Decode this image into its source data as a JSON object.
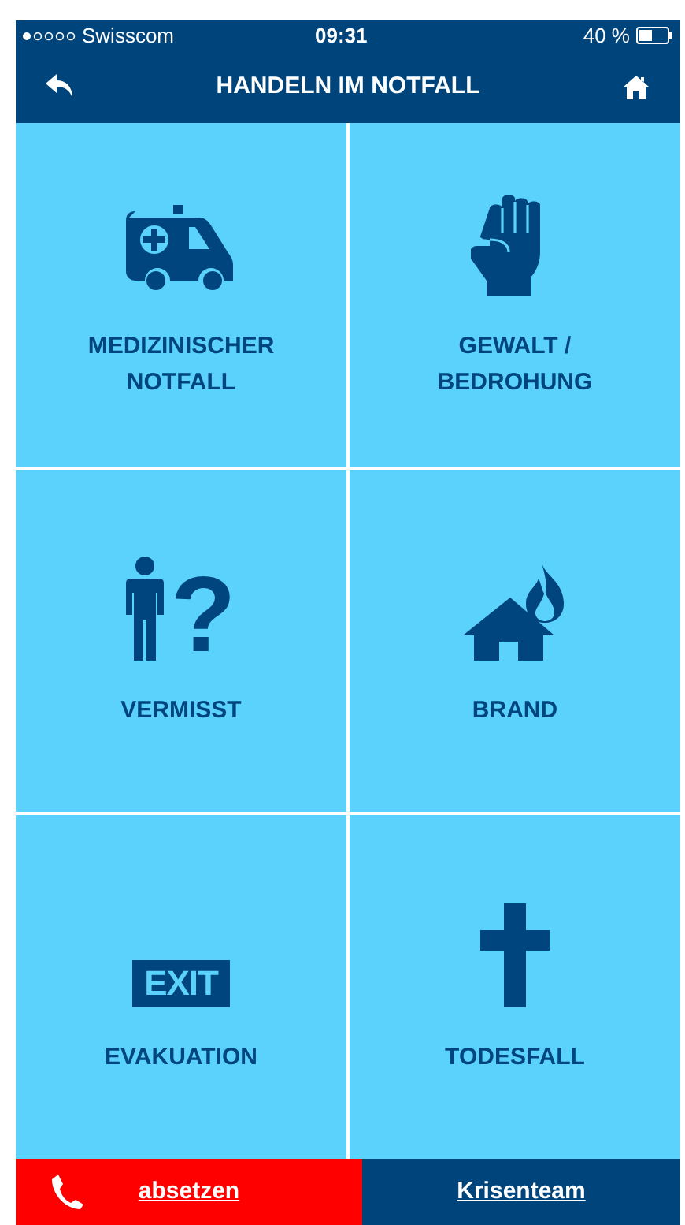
{
  "status_bar": {
    "carrier": "Swisscom",
    "time": "09:31",
    "battery": "40 %"
  },
  "nav_bar": {
    "title": "HANDELN IM NOTFALL"
  },
  "tiles": [
    {
      "kind": "ambulance",
      "label": "MEDIZINISCHER NOTFALL"
    },
    {
      "kind": "fist",
      "label": "GEWALT / BEDROHUNG"
    },
    {
      "kind": "missing-person",
      "icon_text": "?",
      "label": "VERMISST"
    },
    {
      "kind": "house-fire",
      "label": "BRAND"
    },
    {
      "kind": "exit-sign",
      "icon_text": "EXIT",
      "label": "EVAKUATION"
    },
    {
      "kind": "cross",
      "label": "TODESFALL"
    }
  ],
  "bottom_bar": {
    "call_button": "absetzen",
    "team_button": "Krisenteam"
  }
}
